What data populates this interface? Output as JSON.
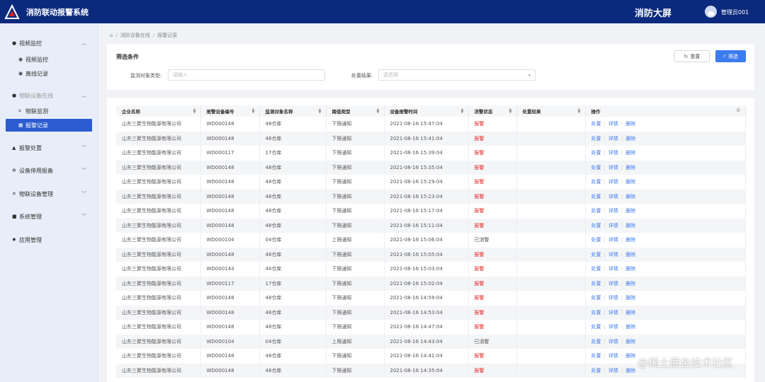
{
  "header": {
    "app_title": "消防联动报警系统",
    "big_screen": "消防大屏",
    "username": "管理员001"
  },
  "sidebar": {
    "items": [
      {
        "label": "视频监控",
        "icon": "camera-icon",
        "expanded": true
      },
      {
        "label": "视频监控",
        "icon": "dot-icon",
        "sub": true
      },
      {
        "label": "离线记录",
        "icon": "dot-icon",
        "sub": true
      },
      {
        "label": "物联设备在线",
        "icon": "bulb-icon",
        "expanded": true
      },
      {
        "label": "物联监测",
        "icon": "grid-icon",
        "sub": true
      },
      {
        "label": "报警记录",
        "icon": "table-icon",
        "sub": true,
        "active": true
      },
      {
        "label": "报警处置",
        "icon": "warning-icon"
      },
      {
        "label": "设备停用报备",
        "icon": "gear-icon"
      },
      {
        "label": "物联设备管理",
        "icon": "tools-icon"
      },
      {
        "label": "系统管理",
        "icon": "system-icon"
      },
      {
        "label": "应用管理",
        "icon": "settings-icon"
      }
    ]
  },
  "breadcrumb": {
    "items": [
      "消防设备在线",
      "报警记录"
    ]
  },
  "filter": {
    "title": "筛选条件",
    "object_type_label": "监测对象类型:",
    "object_type_placeholder": "请输入",
    "result_label": "处置结果:",
    "result_placeholder": "请选择",
    "reset_label": "重置",
    "filter_label": "筛选"
  },
  "table": {
    "columns": [
      "企业名称",
      "报警设备编号",
      "监测对象名称",
      "阈值类型",
      "设备报警时间",
      "消警状态",
      "处置结果",
      "操作"
    ],
    "actions": [
      "处置",
      "详情",
      "删除"
    ],
    "rows": [
      [
        "山东三聚生物能源有限公司",
        "WD000148",
        "48仓库",
        "下限通知",
        "2021-08-16 15:47:04",
        "报警",
        ""
      ],
      [
        "山东三聚生物能源有限公司",
        "WD000148",
        "48仓库",
        "下限通知",
        "2021-08-16 15:41:04",
        "报警",
        ""
      ],
      [
        "山东三聚生物能源有限公司",
        "WD000117",
        "17仓库",
        "下限通知",
        "2021-08-16 15:39:04",
        "报警",
        ""
      ],
      [
        "山东三聚生物能源有限公司",
        "WD000148",
        "48仓库",
        "下限通知",
        "2021-08-16 15:35:04",
        "报警",
        ""
      ],
      [
        "山东三聚生物能源有限公司",
        "WD000148",
        "48仓库",
        "下限通知",
        "2021-08-16 15:29:04",
        "报警",
        ""
      ],
      [
        "山东三聚生物能源有限公司",
        "WD000148",
        "48仓库",
        "下限通知",
        "2021-08-16 15:23:04",
        "报警",
        ""
      ],
      [
        "山东三聚生物能源有限公司",
        "WD000148",
        "48仓库",
        "下限通知",
        "2021-08-16 15:17:04",
        "报警",
        ""
      ],
      [
        "山东三聚生物能源有限公司",
        "WD000148",
        "48仓库",
        "下限通知",
        "2021-08-16 15:11:04",
        "报警",
        ""
      ],
      [
        "山东三聚生物能源有限公司",
        "WD000104",
        "04仓库",
        "上限通知",
        "2021-08-16 15:06:04",
        "已消警",
        ""
      ],
      [
        "山东三聚生物能源有限公司",
        "WD000148",
        "48仓库",
        "下限通知",
        "2021-08-16 15:05:04",
        "报警",
        ""
      ],
      [
        "山东三聚生物能源有限公司",
        "WD000144",
        "44仓库",
        "下限通知",
        "2021-08-16 15:03:04",
        "报警",
        ""
      ],
      [
        "山东三聚生物能源有限公司",
        "WD000117",
        "17仓库",
        "下限通知",
        "2021-08-16 15:02:04",
        "报警",
        ""
      ],
      [
        "山东三聚生物能源有限公司",
        "WD000148",
        "48仓库",
        "下限通知",
        "2021-08-16 14:59:04",
        "报警",
        ""
      ],
      [
        "山东三聚生物能源有限公司",
        "WD000148",
        "48仓库",
        "下限通知",
        "2021-08-16 14:53:04",
        "报警",
        ""
      ],
      [
        "山东三聚生物能源有限公司",
        "WD000148",
        "48仓库",
        "下限通知",
        "2021-08-16 14:47:04",
        "报警",
        ""
      ],
      [
        "山东三聚生物能源有限公司",
        "WD000104",
        "04仓库",
        "上限通知",
        "2021-08-16 14:43:04",
        "已消警",
        ""
      ],
      [
        "山东三聚生物能源有限公司",
        "WD000148",
        "48仓库",
        "下限通知",
        "2021-08-16 14:41:04",
        "报警",
        ""
      ],
      [
        "山东三聚生物能源有限公司",
        "WD000148",
        "48仓库",
        "下限通知",
        "2021-08-16 14:35:04",
        "报警",
        ""
      ]
    ]
  },
  "watermark": "@稀土掘金技术社区",
  "colors": {
    "header_bg": "#0b2a7d",
    "active_menu": "#2b5bd0",
    "primary": "#3d7bf0",
    "alarm": "#e02020"
  }
}
